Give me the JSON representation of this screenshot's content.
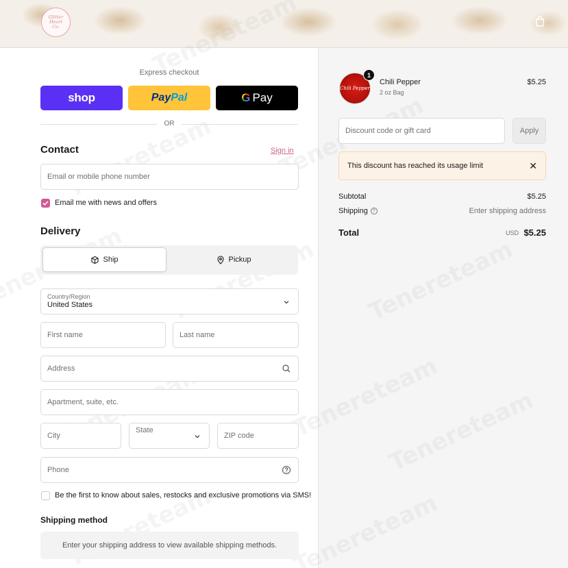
{
  "header": {
    "logo_text": "Glitter\nHeart\nCo."
  },
  "express": {
    "label": "Express checkout",
    "shop_label": "shop",
    "paypal_part1": "Pay",
    "paypal_part2": "Pal",
    "gpay_g": "G",
    "gpay_label": "Pay",
    "or_label": "OR"
  },
  "contact": {
    "title": "Contact",
    "signin_label": "Sign in",
    "email_placeholder": "Email or mobile phone number",
    "newsletter_label": "Email me with news and offers",
    "newsletter_checked": true
  },
  "delivery": {
    "title": "Delivery",
    "ship_label": "Ship",
    "pickup_label": "Pickup",
    "country_label": "Country/Region",
    "country_value": "United States",
    "first_name_placeholder": "First name",
    "last_name_placeholder": "Last name",
    "address_placeholder": "Address",
    "apartment_placeholder": "Apartment, suite, etc.",
    "city_placeholder": "City",
    "state_placeholder": "State",
    "zip_placeholder": "ZIP code",
    "phone_placeholder": "Phone",
    "sms_label": "Be the first to know about sales, restocks and exclusive promotions via SMS!",
    "sms_checked": false
  },
  "shipping_method": {
    "title": "Shipping method",
    "message": "Enter your shipping address to view available shipping methods."
  },
  "order": {
    "product": {
      "name": "Chili Pepper",
      "variant": "2 oz Bag",
      "price": "$5.25",
      "quantity": "1",
      "image_text": "Chili Pepper"
    },
    "discount_placeholder": "Discount code or gift card",
    "apply_label": "Apply",
    "notice_text": "This discount has reached its usage limit",
    "subtotal_label": "Subtotal",
    "subtotal_value": "$5.25",
    "shipping_label": "Shipping",
    "shipping_value": "Enter shipping address",
    "total_label": "Total",
    "currency": "USD",
    "total_value": "$5.25"
  },
  "colors": {
    "shop_purple": "#5a31f4",
    "paypal_yellow": "#ffc439",
    "accent_pink": "#d05a95",
    "notice_bg": "#fdf2e6"
  },
  "watermark": "Tenereteam"
}
